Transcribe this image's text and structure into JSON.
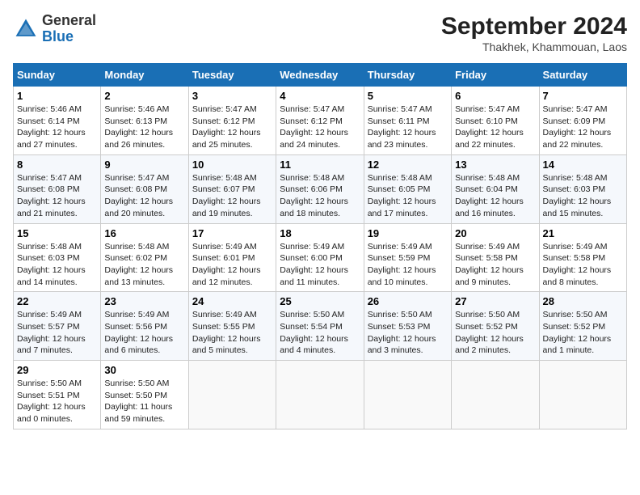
{
  "header": {
    "logo_general": "General",
    "logo_blue": "Blue",
    "month_year": "September 2024",
    "location": "Thakhek, Khammouan, Laos"
  },
  "weekdays": [
    "Sunday",
    "Monday",
    "Tuesday",
    "Wednesday",
    "Thursday",
    "Friday",
    "Saturday"
  ],
  "weeks": [
    [
      {
        "day": "1",
        "sunrise": "5:46 AM",
        "sunset": "6:14 PM",
        "daylight": "12 hours and 27 minutes."
      },
      {
        "day": "2",
        "sunrise": "5:46 AM",
        "sunset": "6:13 PM",
        "daylight": "12 hours and 26 minutes."
      },
      {
        "day": "3",
        "sunrise": "5:47 AM",
        "sunset": "6:12 PM",
        "daylight": "12 hours and 25 minutes."
      },
      {
        "day": "4",
        "sunrise": "5:47 AM",
        "sunset": "6:12 PM",
        "daylight": "12 hours and 24 minutes."
      },
      {
        "day": "5",
        "sunrise": "5:47 AM",
        "sunset": "6:11 PM",
        "daylight": "12 hours and 23 minutes."
      },
      {
        "day": "6",
        "sunrise": "5:47 AM",
        "sunset": "6:10 PM",
        "daylight": "12 hours and 22 minutes."
      },
      {
        "day": "7",
        "sunrise": "5:47 AM",
        "sunset": "6:09 PM",
        "daylight": "12 hours and 22 minutes."
      }
    ],
    [
      {
        "day": "8",
        "sunrise": "5:47 AM",
        "sunset": "6:08 PM",
        "daylight": "12 hours and 21 minutes."
      },
      {
        "day": "9",
        "sunrise": "5:47 AM",
        "sunset": "6:08 PM",
        "daylight": "12 hours and 20 minutes."
      },
      {
        "day": "10",
        "sunrise": "5:48 AM",
        "sunset": "6:07 PM",
        "daylight": "12 hours and 19 minutes."
      },
      {
        "day": "11",
        "sunrise": "5:48 AM",
        "sunset": "6:06 PM",
        "daylight": "12 hours and 18 minutes."
      },
      {
        "day": "12",
        "sunrise": "5:48 AM",
        "sunset": "6:05 PM",
        "daylight": "12 hours and 17 minutes."
      },
      {
        "day": "13",
        "sunrise": "5:48 AM",
        "sunset": "6:04 PM",
        "daylight": "12 hours and 16 minutes."
      },
      {
        "day": "14",
        "sunrise": "5:48 AM",
        "sunset": "6:03 PM",
        "daylight": "12 hours and 15 minutes."
      }
    ],
    [
      {
        "day": "15",
        "sunrise": "5:48 AM",
        "sunset": "6:03 PM",
        "daylight": "12 hours and 14 minutes."
      },
      {
        "day": "16",
        "sunrise": "5:48 AM",
        "sunset": "6:02 PM",
        "daylight": "12 hours and 13 minutes."
      },
      {
        "day": "17",
        "sunrise": "5:49 AM",
        "sunset": "6:01 PM",
        "daylight": "12 hours and 12 minutes."
      },
      {
        "day": "18",
        "sunrise": "5:49 AM",
        "sunset": "6:00 PM",
        "daylight": "12 hours and 11 minutes."
      },
      {
        "day": "19",
        "sunrise": "5:49 AM",
        "sunset": "5:59 PM",
        "daylight": "12 hours and 10 minutes."
      },
      {
        "day": "20",
        "sunrise": "5:49 AM",
        "sunset": "5:58 PM",
        "daylight": "12 hours and 9 minutes."
      },
      {
        "day": "21",
        "sunrise": "5:49 AM",
        "sunset": "5:58 PM",
        "daylight": "12 hours and 8 minutes."
      }
    ],
    [
      {
        "day": "22",
        "sunrise": "5:49 AM",
        "sunset": "5:57 PM",
        "daylight": "12 hours and 7 minutes."
      },
      {
        "day": "23",
        "sunrise": "5:49 AM",
        "sunset": "5:56 PM",
        "daylight": "12 hours and 6 minutes."
      },
      {
        "day": "24",
        "sunrise": "5:49 AM",
        "sunset": "5:55 PM",
        "daylight": "12 hours and 5 minutes."
      },
      {
        "day": "25",
        "sunrise": "5:50 AM",
        "sunset": "5:54 PM",
        "daylight": "12 hours and 4 minutes."
      },
      {
        "day": "26",
        "sunrise": "5:50 AM",
        "sunset": "5:53 PM",
        "daylight": "12 hours and 3 minutes."
      },
      {
        "day": "27",
        "sunrise": "5:50 AM",
        "sunset": "5:52 PM",
        "daylight": "12 hours and 2 minutes."
      },
      {
        "day": "28",
        "sunrise": "5:50 AM",
        "sunset": "5:52 PM",
        "daylight": "12 hours and 1 minute."
      }
    ],
    [
      {
        "day": "29",
        "sunrise": "5:50 AM",
        "sunset": "5:51 PM",
        "daylight": "12 hours and 0 minutes."
      },
      {
        "day": "30",
        "sunrise": "5:50 AM",
        "sunset": "5:50 PM",
        "daylight": "11 hours and 59 minutes."
      },
      null,
      null,
      null,
      null,
      null
    ]
  ]
}
